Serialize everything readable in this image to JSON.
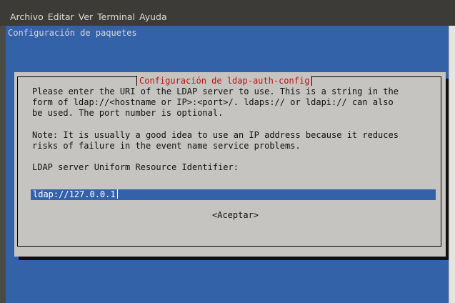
{
  "menubar": {
    "items": [
      "Archivo",
      "Editar",
      "Ver",
      "Terminal",
      "Ayuda"
    ]
  },
  "terminal": {
    "title": "Configuración de paquetes"
  },
  "dialog": {
    "title": "Configuración de ldap-auth-config",
    "paragraph1": [
      "Please enter the URI of the LDAP server to use. This is a string in the",
      "form of ldap://<hostname or IP>:<port>/. ldaps:// or ldapi:// can also",
      "be used. The port number is optional."
    ],
    "paragraph2": [
      "Note: It is usually a good idea to use an IP address because it reduces",
      "risks of failure in the event name service problems."
    ],
    "prompt": "LDAP server Uniform Resource Identifier:",
    "input_value": "ldap://127.0.0.1",
    "ok_label": "<Aceptar>"
  },
  "colors": {
    "terminal_bg": "#3462a8",
    "dialog_bg": "#c6c4c0",
    "dialog_title": "#c21010",
    "menubar_bg": "#3c3b37"
  }
}
